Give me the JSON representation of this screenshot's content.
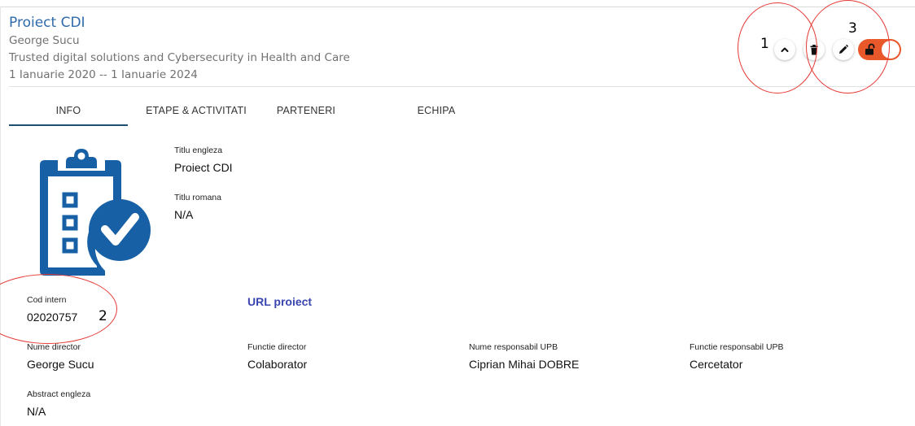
{
  "header": {
    "project_title": "Proiect CDI",
    "director": "George Sucu",
    "description": "Trusted digital solutions and Cybersecurity in Health and Care",
    "period": "1 Ianuarie 2020 -- 1 Ianuarie 2024"
  },
  "tabs": [
    {
      "label": "INFO",
      "active": true
    },
    {
      "label": "ETAPE & ACTIVITATI",
      "active": false
    },
    {
      "label": "PARTENERI",
      "active": false
    },
    {
      "label": "ECHIPA",
      "active": false
    }
  ],
  "actions": {
    "collapse_icon": "chevron-up-icon",
    "delete_icon": "trash-icon",
    "edit_icon": "pencil-icon",
    "lock_toggle_icon": "unlock-icon",
    "lock_toggle_color": "#e8582a"
  },
  "info": {
    "illustration_icon": "clipboard-check-icon",
    "illustration_color": "#1760a5",
    "titlu_engleza": {
      "label": "Titlu engleza",
      "value": "Proiect CDI"
    },
    "titlu_romana": {
      "label": "Titlu romana",
      "value": "N/A"
    },
    "cod_intern": {
      "label": "Cod intern",
      "value": "02020757"
    },
    "url_proiect": {
      "label": "URL proiect",
      "color": "#3a46b0"
    },
    "nume_director": {
      "label": "Nume director",
      "value": "George Sucu"
    },
    "functie_director": {
      "label": "Functie director",
      "value": "Colaborator"
    },
    "nume_responsabil": {
      "label": "Nume responsabil UPB",
      "value": "Ciprian Mihai DOBRE"
    },
    "functie_responsabil": {
      "label": "Functie responsabil UPB",
      "value": "Cercetator"
    },
    "abstract_engleza": {
      "label": "Abstract engleza",
      "value": "N/A"
    }
  },
  "annotations": [
    {
      "number": "1",
      "color": "#e53935"
    },
    {
      "number": "2",
      "color": "#e53935"
    },
    {
      "number": "3",
      "color": "#e53935"
    }
  ]
}
